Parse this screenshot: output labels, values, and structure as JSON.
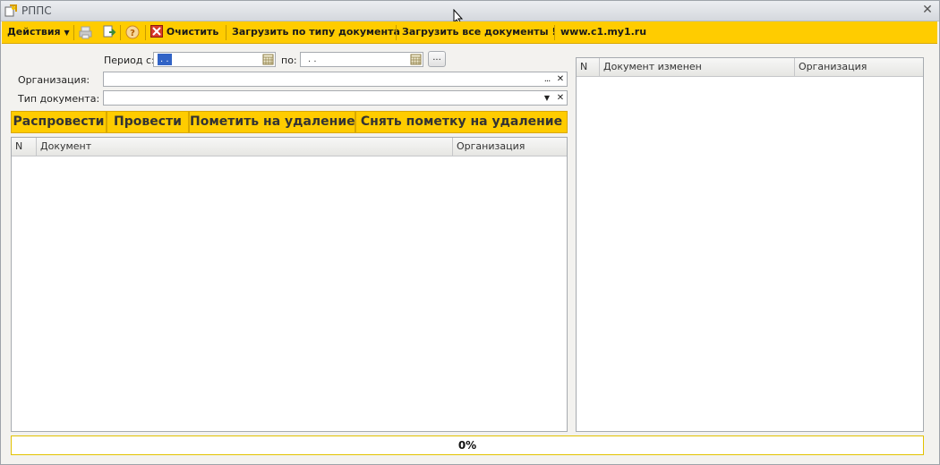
{
  "window": {
    "title": "РППС"
  },
  "toolbar": {
    "actions_label": "Действия",
    "clear_label": "Очистить",
    "load_by_type_label": "Загрузить по типу документа",
    "load_all_label": "Загрузить все документы !",
    "site_label": "www.c1.my1.ru"
  },
  "filters": {
    "period_from_label": "Период с:",
    "period_from_value": ". .",
    "period_to_label": "по:",
    "period_to_value": ". .",
    "period_more_label": "...",
    "organization_label": "Организация:",
    "organization_value": "",
    "doc_type_label": "Тип документа:",
    "doc_type_value": ""
  },
  "actions": {
    "repost_label": "Распровести",
    "post_label": "Провести",
    "mark_delete_label": "Пометить на удаление",
    "unmark_delete_label": "Снять пометку на удаление"
  },
  "left_table": {
    "columns": [
      "N",
      "Документ",
      "Организация"
    ]
  },
  "right_table": {
    "columns": [
      "N",
      "Документ изменен",
      "Организация"
    ]
  },
  "progress": {
    "value": 0,
    "label": "0%"
  },
  "colors": {
    "accent": "#ffcc00",
    "selection": "#3163c6"
  },
  "icons": [
    "app-icon",
    "close-icon",
    "dropdown-arrow-icon",
    "print-icon",
    "export-icon",
    "help-icon",
    "clear-icon",
    "calendar-icon",
    "choose-icon",
    "clear-field-icon"
  ]
}
